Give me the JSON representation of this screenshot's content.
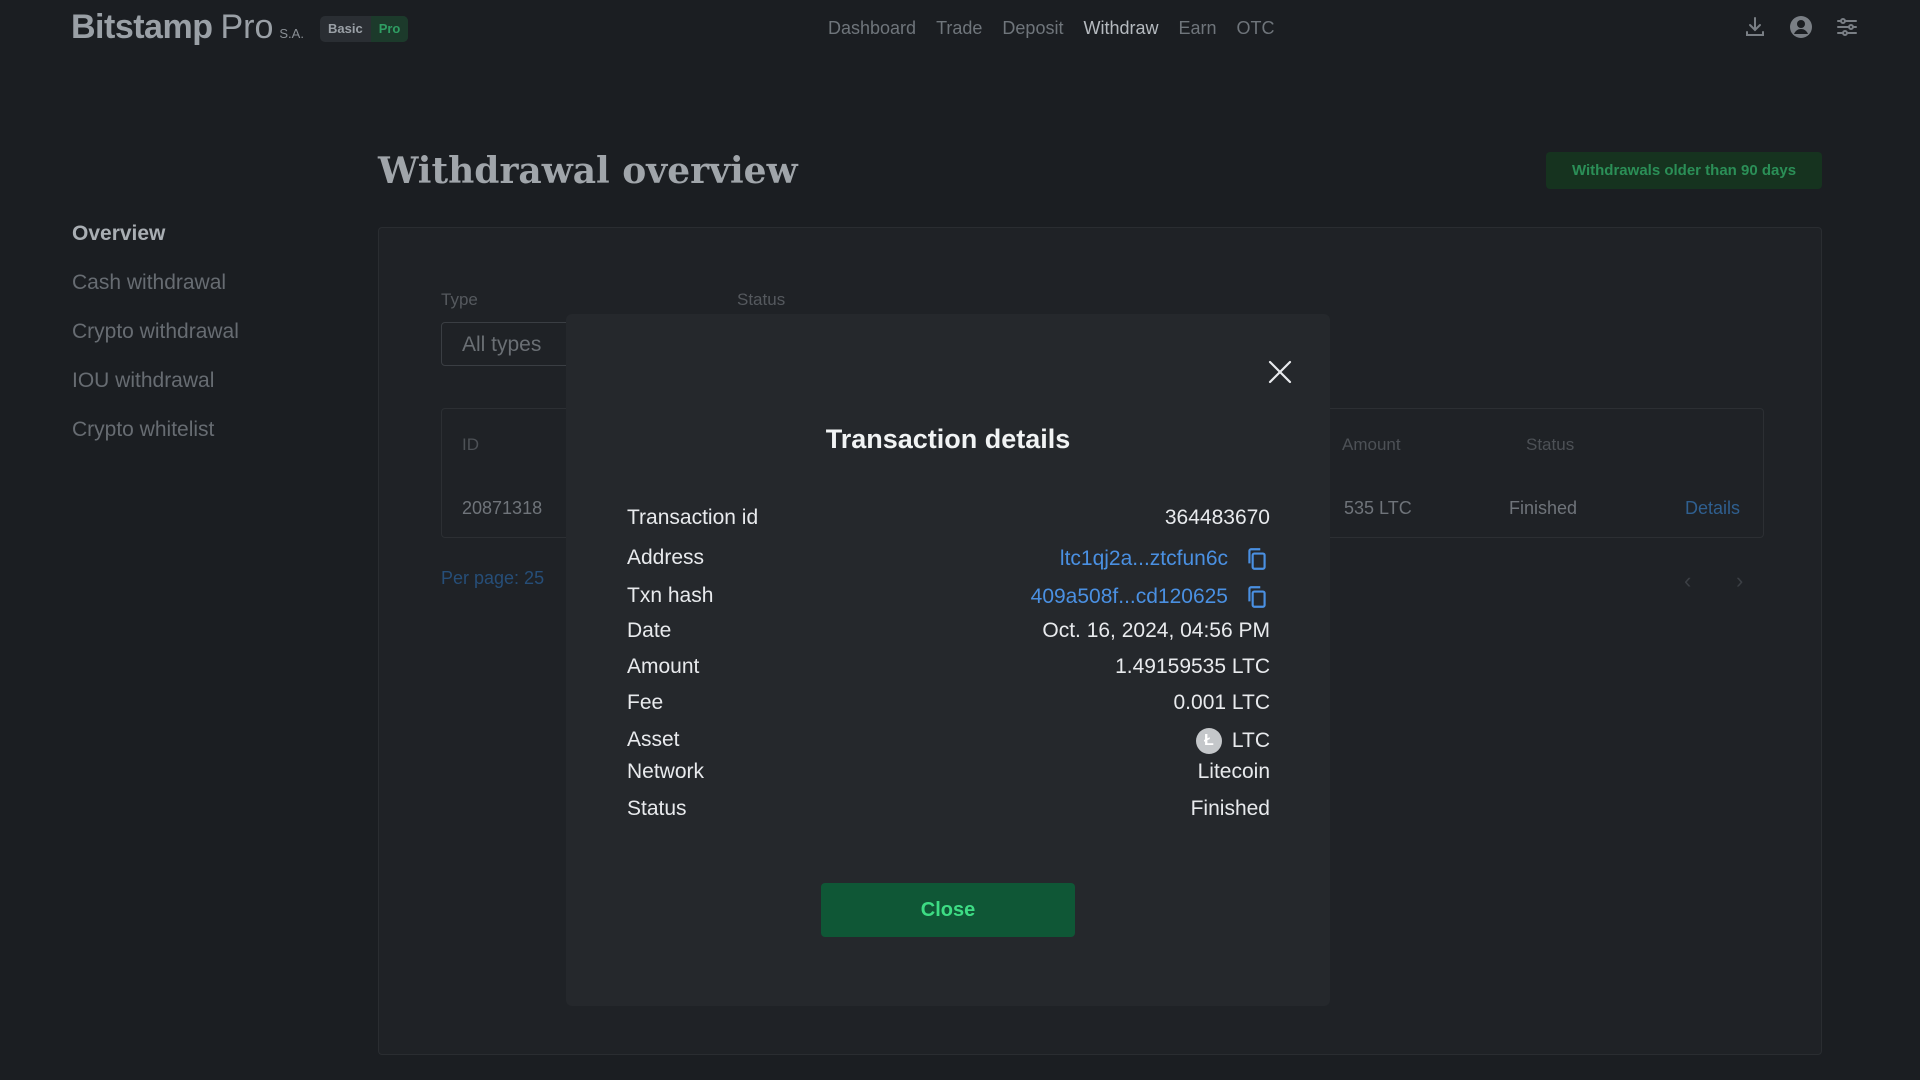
{
  "header": {
    "brand": "Bitstamp",
    "brand_suffix": "Pro",
    "brand_entity": "S.A.",
    "mode_options": [
      "Basic",
      "Pro"
    ],
    "nav": [
      "Dashboard",
      "Trade",
      "Deposit",
      "Withdraw",
      "Earn",
      "OTC"
    ],
    "active_nav": "Withdraw",
    "icons": [
      "download-icon",
      "account-icon",
      "settings-sliders-icon"
    ]
  },
  "page": {
    "title": "Withdrawal overview",
    "old_withdrawals_button": "Withdrawals older than 90 days"
  },
  "sidebar": {
    "items": [
      "Overview",
      "Cash withdrawal",
      "Crypto withdrawal",
      "IOU withdrawal",
      "Crypto whitelist"
    ],
    "active": "Overview"
  },
  "filters": {
    "type_label": "Type",
    "type_value": "All types",
    "status_label": "Status"
  },
  "table": {
    "headers": {
      "id": "ID",
      "amount": "Amount",
      "status": "Status"
    },
    "rows": [
      {
        "id": "20871318",
        "amount_partial": "535 LTC",
        "status": "Finished",
        "action": "Details"
      }
    ],
    "per_page": "Per page: 25"
  },
  "modal": {
    "title": "Transaction details",
    "rows": [
      {
        "label": "Transaction id",
        "value": "364483670"
      },
      {
        "label": "Address",
        "value": "ltc1qj2a...ztcfun6c",
        "copy": true
      },
      {
        "label": "Txn hash",
        "value": "409a508f...cd120625",
        "copy": true
      },
      {
        "label": "Date",
        "value": "Oct. 16, 2024, 04:56 PM"
      },
      {
        "label": "Amount",
        "value": "1.49159535 LTC"
      },
      {
        "label": "Fee",
        "value": "0.001 LTC"
      },
      {
        "label": "Asset",
        "value": "LTC",
        "asset_icon": "litecoin-icon",
        "asset_glyph": "Ł"
      },
      {
        "label": "Network",
        "value": "Litecoin"
      },
      {
        "label": "Status",
        "value": "Finished"
      }
    ],
    "close_button": "Close"
  },
  "colors": {
    "background": "#1b1e22",
    "modal_bg": "#25282c",
    "link_blue": "#4a90e2",
    "accent_green": "#3ddc84",
    "button_green_bg": "#0f5736"
  }
}
